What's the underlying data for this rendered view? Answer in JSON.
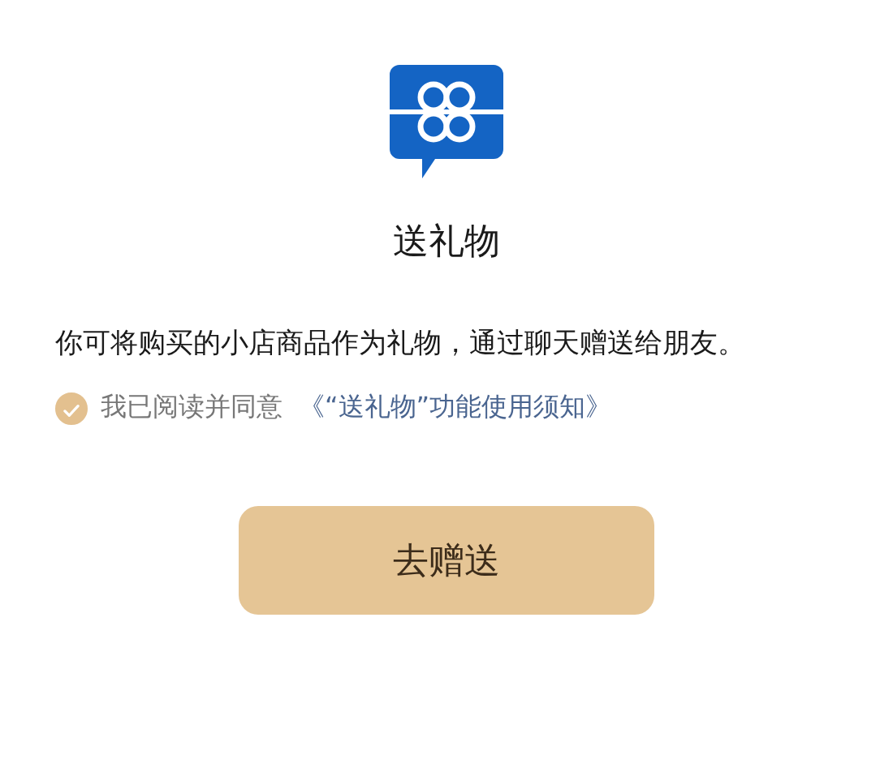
{
  "title": "送礼物",
  "description": "你可将购买的小店商品作为礼物，通过聊天赠送给朋友。",
  "agreement": {
    "checked": true,
    "label": "我已阅读并同意",
    "link": "《“送礼物”功能使用须知》"
  },
  "button": "去赠送"
}
